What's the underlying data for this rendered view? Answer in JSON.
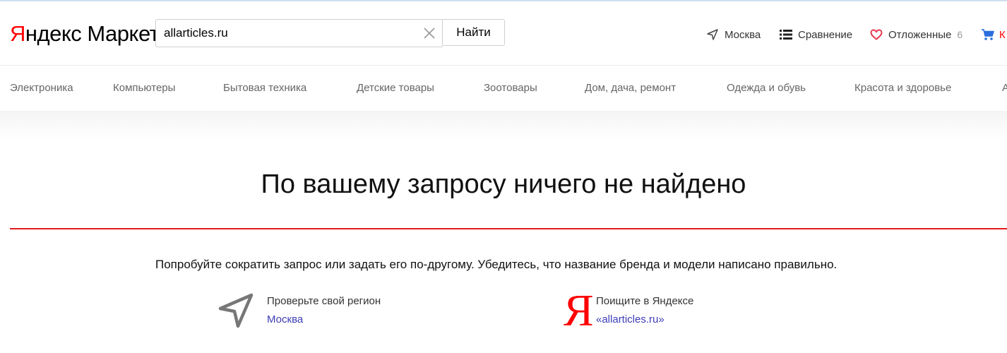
{
  "logo": {
    "ya": "Я",
    "ndeks": "ндекс",
    "market": "Маркет"
  },
  "search": {
    "value": "allarticles.ru",
    "placeholder": "",
    "button_label": "Найти"
  },
  "header": {
    "region": "Москва",
    "compare": "Сравнение",
    "saved": "Отложенные",
    "saved_count": "6",
    "cart": "К"
  },
  "nav": {
    "items": [
      "Электроника",
      "Компьютеры",
      "Бытовая техника",
      "Детские товары",
      "Зоотовары",
      "Дом, дача, ремонт",
      "Одежда и обувь",
      "Красота и здоровье",
      "А"
    ]
  },
  "main": {
    "title": "По вашему запросу ничего не найдено",
    "hint": "Попробуйте сократить запрос или задать его по-другому. Убедитесь, что название бренда и модели написано правильно.",
    "region_tip": {
      "title": "Проверьте свой регион",
      "link": "Москва"
    },
    "yandex_tip": {
      "logo": "Я",
      "title": "Поищите в Яндексе",
      "link": "«allarticles.ru»"
    }
  },
  "colors": {
    "accent_red": "#ff0000",
    "link": "#3d3db8",
    "divider": "#e21a1a"
  }
}
